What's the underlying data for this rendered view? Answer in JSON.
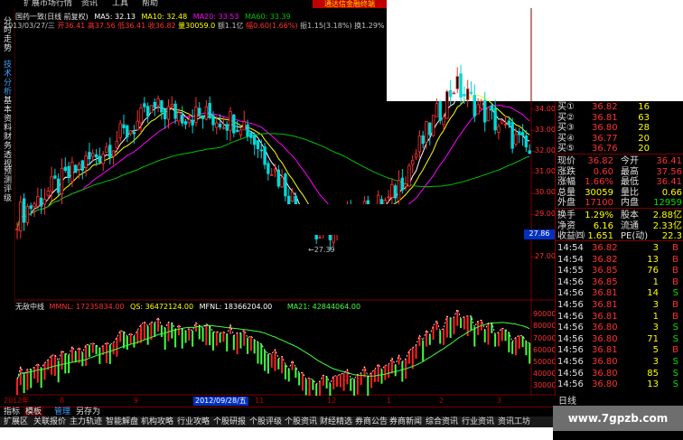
{
  "menu": {
    "items": [
      "扩展市场行情",
      "资讯",
      "工具",
      "帮助"
    ],
    "banner": "通达信金融终端"
  },
  "sidetabs": [
    "分时走势",
    "技术分析",
    "基本资料",
    "财务透视",
    "预测评级"
  ],
  "header": {
    "stock": "国药一致(日线 前复权)",
    "ma5": "MA5: 32.13",
    "ma10": "MA10: 32.48",
    "ma20": "MA20: 33.53",
    "ma60": "MA60: 33.39",
    "line2_date": "2013/03/27/三",
    "open": "开36.41",
    "high": "高37.56",
    "low": "低36.41",
    "close": "收36.82",
    "vol": "量30059.0",
    "amount": "额1.1亿",
    "range": "幅0.60(1.66%)",
    "amp": "振1.15(3.18%)",
    "turnover": "换1.29%"
  },
  "price_axis": [
    "34.00",
    "33.00",
    "32.00",
    "31.00",
    "30.00",
    "29.00",
    "28.00",
    "27.00"
  ],
  "current_price_tag": "27.86",
  "low_marker": "←27.39",
  "indicator": {
    "name": "无敌中线",
    "mmnl": "MMNL: 17235834.00",
    "qs": "QS: 36472124.00",
    "mfnl": "MFNL: 18366204.00",
    "ma21": "MA21: 42844064.00",
    "axis": [
      "90000",
      "80000",
      "70000",
      "60000",
      "50000",
      "40000",
      "30000"
    ]
  },
  "dates": {
    "a": "2012年",
    "b": "8",
    "c": "9",
    "d": "2012/09/28/五",
    "e": "11",
    "f": "12",
    "g": "1",
    "h": "2",
    "i": "3"
  },
  "tabs": [
    "指标",
    "模板",
    "管理",
    "另存为"
  ],
  "bottom": [
    "扩展区",
    "关联报价",
    "主力轨迹",
    "智能解盘",
    "机构攻略",
    "行业攻略",
    "个股研报",
    "个股评级",
    "个股资讯",
    "财经精选",
    "券商公告",
    "券商新闻",
    "综合资讯",
    "行业资讯",
    "资讯工坊"
  ],
  "quotes": {
    "asks": [
      {
        "label": "买①",
        "price": "36.82",
        "vol": "16"
      },
      {
        "label": "买②",
        "price": "36.81",
        "vol": "63"
      },
      {
        "label": "买③",
        "price": "36.80",
        "vol": "28"
      },
      {
        "label": "买④",
        "price": "36.77",
        "vol": "20"
      },
      {
        "label": "买⑤",
        "price": "36.76",
        "vol": "20"
      }
    ],
    "stats": [
      {
        "l1": "现价",
        "v1": "36.82",
        "l2": "今开",
        "v2": "36.41"
      },
      {
        "l1": "涨跌",
        "v1": "0.60",
        "l2": "最高",
        "v2": "37.56"
      },
      {
        "l1": "涨幅",
        "v1": "1.66%",
        "l2": "最低",
        "v2": "36.41"
      },
      {
        "l1": "总量",
        "v1": "30059",
        "l2": "量比",
        "v2": "0.66"
      },
      {
        "l1": "外盘",
        "v1": "17100",
        "l2": "内盘",
        "v2": "12959"
      }
    ],
    "stats2": [
      {
        "l1": "换手",
        "v1": "1.29%",
        "l2": "股本",
        "v2": "2.88亿"
      },
      {
        "l1": "净资",
        "v1": "6.16",
        "l2": "流通",
        "v2": "2.33亿"
      },
      {
        "l1": "收益㈣",
        "v1": "1.651",
        "l2": "PE(动)",
        "v2": "22.3"
      }
    ],
    "ticks": [
      {
        "t": "14:54",
        "p": "36.82",
        "v": "3",
        "d": "B"
      },
      {
        "t": "14:54",
        "p": "36.82",
        "v": "13",
        "d": "B"
      },
      {
        "t": "14:55",
        "p": "36.85",
        "v": "76",
        "d": "B"
      },
      {
        "t": "14:56",
        "p": "36.85",
        "v": "1",
        "d": "B"
      },
      {
        "t": "14:56",
        "p": "36.81",
        "v": "14",
        "d": "S"
      },
      {
        "t": "14:56",
        "p": "36.81",
        "v": "3",
        "d": "B"
      },
      {
        "t": "14:56",
        "p": "36.81",
        "v": "1",
        "d": "B"
      },
      {
        "t": "14:56",
        "p": "36.80",
        "v": "3",
        "d": "S"
      },
      {
        "t": "14:56",
        "p": "36.80",
        "v": "71",
        "d": "S"
      },
      {
        "t": "14:56",
        "p": "36.81",
        "v": "5",
        "d": "B"
      },
      {
        "t": "14:56",
        "p": "36.80",
        "v": "3",
        "d": "S"
      },
      {
        "t": "14:56",
        "p": "36.80",
        "v": "85",
        "d": "S"
      },
      {
        "t": "14:56",
        "p": "36.80",
        "v": "13",
        "d": "S"
      }
    ],
    "footer": "日线"
  },
  "watermark": "www.7gpzb.com",
  "colors": {
    "up": "#ff3030",
    "down": "#00d8d8",
    "ma5": "#ffffff",
    "ma10": "#ffff00",
    "ma20": "#ff00ff",
    "ma60": "#00c000",
    "vol_up": "#ff2020",
    "vol_down": "#40ff40"
  }
}
